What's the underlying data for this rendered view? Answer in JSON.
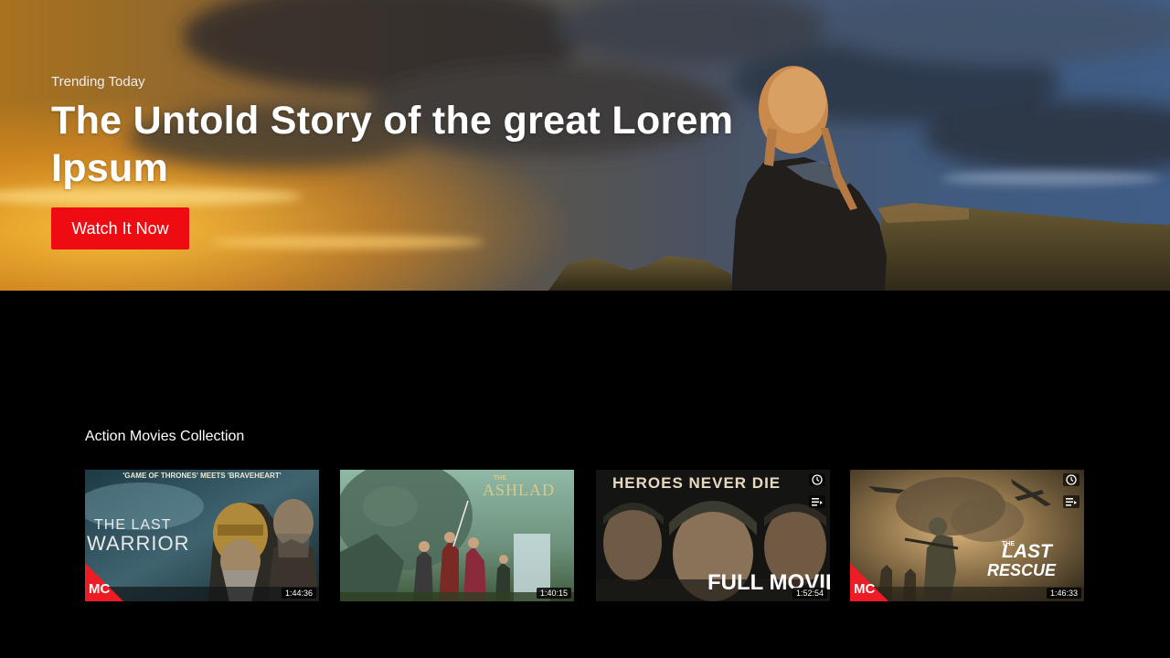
{
  "hero": {
    "kicker": "Trending Today",
    "title": "The Untold Story of the great Lorem Ipsum",
    "cta_label": "Watch It Now"
  },
  "collection": {
    "title": "Action Movies Collection",
    "items": [
      {
        "tagline": "'GAME OF THRONES' MEETS 'BRAVEHEART'",
        "title_line1": "THE LAST",
        "title_line2": "WARRIOR",
        "badge": "MC",
        "duration": "1:44:36"
      },
      {
        "title_small": "THE",
        "title": "ASHLAD",
        "duration": "1:40:15"
      },
      {
        "title": "HEROES NEVER DIE",
        "subtitle": "FULL MOVIE",
        "duration": "1:52:54",
        "icons": [
          "clock-icon",
          "playlist-icon"
        ]
      },
      {
        "title_small": "THE",
        "title_line1": "LAST",
        "title_line2": "RESCUE",
        "badge": "MC",
        "duration": "1:46:33",
        "icons": [
          "clock-icon",
          "playlist-icon"
        ]
      }
    ]
  },
  "colors": {
    "accent": "#ee0c12",
    "background": "#000000"
  }
}
